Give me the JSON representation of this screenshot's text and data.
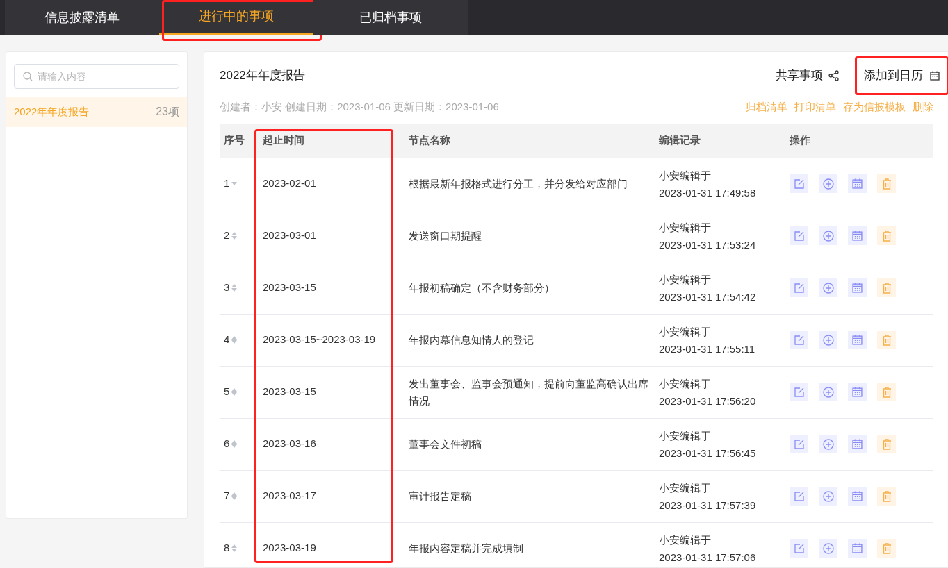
{
  "tabs": [
    {
      "label": "信息披露清单",
      "selected": false,
      "highlighted": false
    },
    {
      "label": "进行中的事项",
      "selected": true,
      "highlighted": true
    },
    {
      "label": "已归档事项",
      "selected": false,
      "highlighted": false
    }
  ],
  "sidebar": {
    "search": {
      "placeholder": "请输入内容"
    },
    "items": [
      {
        "label": "2022年年度报告",
        "count": "23项",
        "selected": true
      }
    ]
  },
  "report": {
    "title": "2022年年度报告",
    "share": {
      "label": "共享事项"
    },
    "calendar": {
      "label": "添加到日历",
      "highlighted": true
    },
    "meta": "创建者：小安 创建日期：2023-01-06 更新日期：2023-01-06",
    "links": [
      "归档清单",
      "打印清单",
      "存为信披模板",
      "删除"
    ]
  },
  "table": {
    "columns": [
      "序号",
      "起止时间",
      "节点名称",
      "编辑记录",
      "操作"
    ],
    "date_column_highlighted": true,
    "rows": [
      {
        "no": "1",
        "can_move_up": false,
        "date": "2023-02-01",
        "name": "根据最新年报格式进行分工，并分发给对应部门",
        "editor": "小安编辑于",
        "time": "2023-01-31 17:49:58"
      },
      {
        "no": "2",
        "can_move_up": true,
        "date": "2023-03-01",
        "name": "发送窗口期提醒",
        "editor": "小安编辑于",
        "time": "2023-01-31 17:53:24"
      },
      {
        "no": "3",
        "can_move_up": true,
        "date": "2023-03-15",
        "name": "年报初稿确定（不含财务部分）",
        "editor": "小安编辑于",
        "time": "2023-01-31 17:54:42"
      },
      {
        "no": "4",
        "can_move_up": true,
        "date": "2023-03-15~2023-03-19",
        "name": "年报内幕信息知情人的登记",
        "editor": "小安编辑于",
        "time": "2023-01-31 17:55:11"
      },
      {
        "no": "5",
        "can_move_up": true,
        "date": "2023-03-15",
        "name": "发出董事会、监事会预通知，提前向董监高确认出席情况",
        "editor": "小安编辑于",
        "time": "2023-01-31 17:56:20"
      },
      {
        "no": "6",
        "can_move_up": true,
        "date": "2023-03-16",
        "name": "董事会文件初稿",
        "editor": "小安编辑于",
        "time": "2023-01-31 17:56:45"
      },
      {
        "no": "7",
        "can_move_up": true,
        "date": "2023-03-17",
        "name": "审计报告定稿",
        "editor": "小安编辑于",
        "time": "2023-01-31 17:57:39"
      },
      {
        "no": "8",
        "can_move_up": true,
        "date": "2023-03-19",
        "name": "年报内容定稿并完成填制",
        "editor": "小安编辑于",
        "time": "2023-01-31 17:57:06"
      }
    ]
  }
}
